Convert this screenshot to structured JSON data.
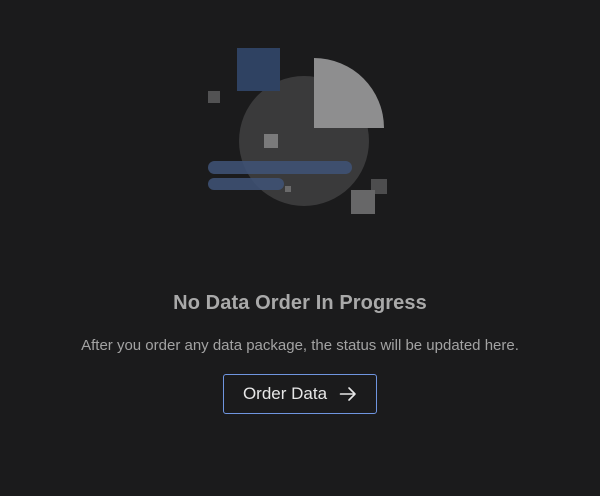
{
  "empty_state": {
    "illustration_icon": "pie-chart-empty-illustration",
    "title": "No Data Order In Progress",
    "description": "After you order any data package, the status will be updated here.",
    "button_label": "Order Data",
    "button_icon": "arrow-right-icon"
  },
  "colors": {
    "background": "#1b1b1c",
    "accent": "#6f95e0",
    "title_text": "#a9a9a9",
    "body_text": "#a3a3a3"
  }
}
